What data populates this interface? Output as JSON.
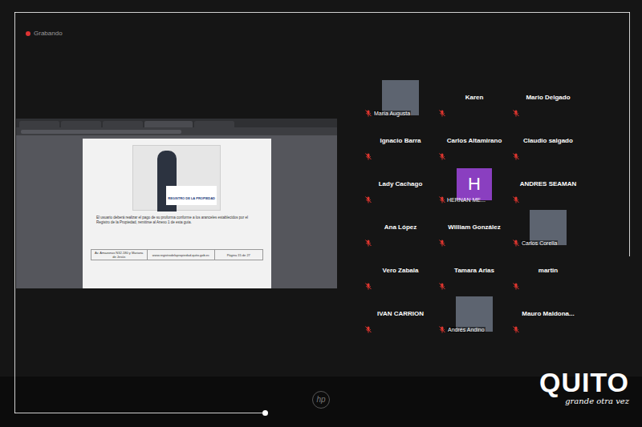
{
  "recording": {
    "label": "Grabando"
  },
  "shared_screen": {
    "document": {
      "brand": "REGISTRO DE LA PROPIEDAD",
      "paragraph": "El usuario deberá realizar el pago de su proforma conforme a los aranceles establecidos por el Registro de la Propiedad, remitirse al Anexo 1 de esta guía.",
      "footer": [
        "Av. Amazonas N32-180 y Mariana de Jesús",
        "www.registrodelapropiedad.quito.gob.ec",
        "Página 15 de 27"
      ]
    }
  },
  "participants": [
    {
      "name": "María Augusta",
      "kind": "video",
      "muted": true
    },
    {
      "name": "Karen",
      "kind": "name",
      "muted": true
    },
    {
      "name": "Mario Delgado",
      "kind": "name",
      "muted": true
    },
    {
      "name": "Ignacio Barra",
      "kind": "name",
      "muted": true
    },
    {
      "name": "Carlos Altamirano",
      "kind": "name",
      "muted": true
    },
    {
      "name": "Claudio salgado",
      "kind": "name",
      "muted": true
    },
    {
      "name": "Lady Cachago",
      "kind": "name",
      "muted": true
    },
    {
      "name": "HERNAN ME...",
      "kind": "avatar",
      "muted": true,
      "avatar": "H",
      "color": "#8a3fc0"
    },
    {
      "name": "ANDRES SEAMAN",
      "kind": "name",
      "muted": true
    },
    {
      "name": "Ana López",
      "kind": "name",
      "muted": true
    },
    {
      "name": "William González",
      "kind": "name",
      "muted": true
    },
    {
      "name": "Carlos Corella",
      "kind": "video",
      "muted": true
    },
    {
      "name": "Vero Zabala",
      "kind": "name",
      "muted": true
    },
    {
      "name": "Tamara Arias",
      "kind": "name",
      "muted": true
    },
    {
      "name": "martin",
      "kind": "name",
      "muted": true
    },
    {
      "name": "IVAN CARRION",
      "kind": "name",
      "muted": true
    },
    {
      "name": "Andrés Andino",
      "kind": "video",
      "muted": true
    },
    {
      "name": "Mauro Maldona...",
      "kind": "name",
      "muted": true
    }
  ],
  "laptop_brand": "hp",
  "logo": {
    "title": "QUITO",
    "tagline": "grande otra vez"
  }
}
